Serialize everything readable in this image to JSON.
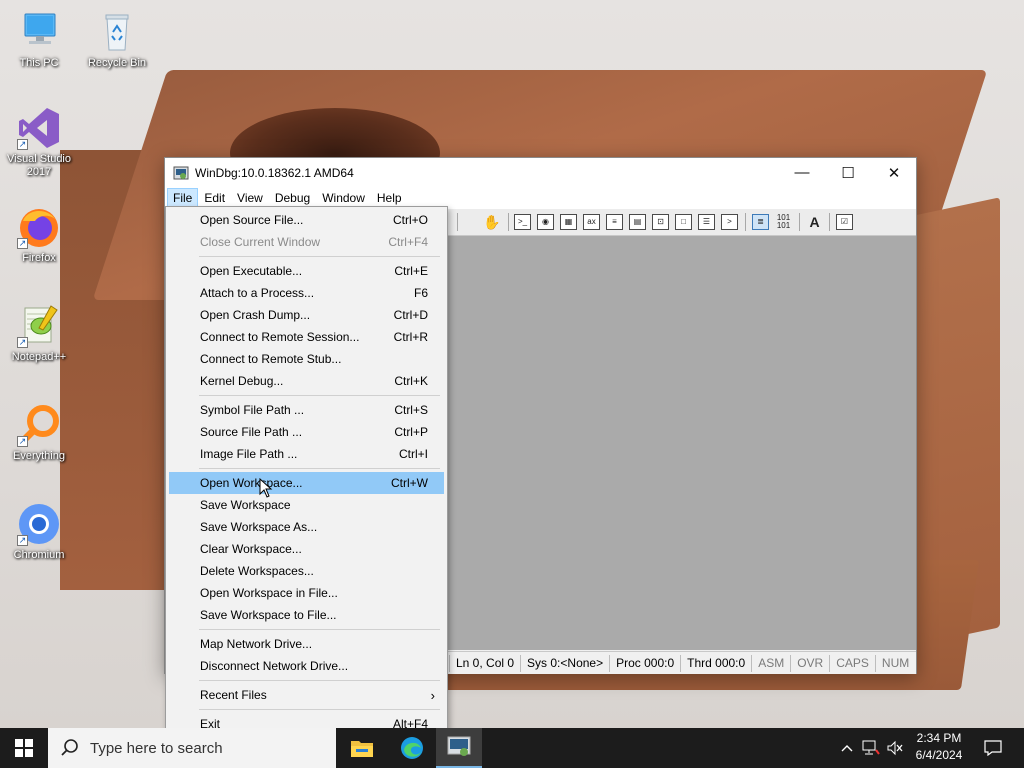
{
  "desktop": {
    "icons": [
      {
        "label": "This PC",
        "icon": "this-pc-icon"
      },
      {
        "label": "Recycle Bin",
        "icon": "recycle-bin-icon"
      },
      {
        "label": "Visual Studio 2017",
        "icon": "visual-studio-icon"
      },
      {
        "label": "Firefox",
        "icon": "firefox-icon"
      },
      {
        "label": "Notepad++",
        "icon": "notepadpp-icon"
      },
      {
        "label": "Everything",
        "icon": "everything-icon"
      },
      {
        "label": "Chromium",
        "icon": "chromium-icon"
      }
    ]
  },
  "window": {
    "title": "WinDbg:10.0.18362.1 AMD64",
    "controls": {
      "minimize": "—",
      "maximize": "☐",
      "close": "✕"
    },
    "menubar": [
      "File",
      "Edit",
      "View",
      "Debug",
      "Window",
      "Help"
    ],
    "toolbar": {
      "buttons": [
        "hand-icon",
        "command-window-icon",
        "watch-icon",
        "locals-icon",
        "registers-icon",
        "memory-icon",
        "call-stack-icon",
        "disassembly-icon",
        "scratch-pad-icon",
        "processes-threads-icon",
        "command-browser-icon",
        "source-mode-icon",
        "hex-mode-icon",
        "font-icon",
        "options-icon"
      ],
      "hex_label": "101",
      "font_label": "A"
    },
    "status": {
      "position": "Ln 0, Col 0",
      "sys": "Sys 0:<None>",
      "proc": "Proc 000:0",
      "thrd": "Thrd 000:0",
      "asm": "ASM",
      "ovr": "OVR",
      "caps": "CAPS",
      "num": "NUM"
    }
  },
  "file_menu": {
    "groups": [
      [
        {
          "label": "Open Source File...",
          "shortcut": "Ctrl+O"
        },
        {
          "label": "Close Current Window",
          "shortcut": "Ctrl+F4",
          "disabled": true
        }
      ],
      [
        {
          "label": "Open Executable...",
          "shortcut": "Ctrl+E"
        },
        {
          "label": "Attach to a Process...",
          "shortcut": "F6"
        },
        {
          "label": "Open Crash Dump...",
          "shortcut": "Ctrl+D"
        },
        {
          "label": "Connect to Remote Session...",
          "shortcut": "Ctrl+R"
        },
        {
          "label": "Connect to Remote Stub...",
          "shortcut": ""
        },
        {
          "label": "Kernel Debug...",
          "shortcut": "Ctrl+K"
        }
      ],
      [
        {
          "label": "Symbol File Path ...",
          "shortcut": "Ctrl+S"
        },
        {
          "label": "Source File Path ...",
          "shortcut": "Ctrl+P"
        },
        {
          "label": "Image File Path ...",
          "shortcut": "Ctrl+I"
        }
      ],
      [
        {
          "label": "Open Workspace...",
          "shortcut": "Ctrl+W",
          "highlighted": true
        },
        {
          "label": "Save Workspace",
          "shortcut": ""
        },
        {
          "label": "Save Workspace As...",
          "shortcut": ""
        },
        {
          "label": "Clear Workspace...",
          "shortcut": ""
        },
        {
          "label": "Delete Workspaces...",
          "shortcut": ""
        },
        {
          "label": "Open Workspace in File...",
          "shortcut": ""
        },
        {
          "label": "Save Workspace to File...",
          "shortcut": ""
        }
      ],
      [
        {
          "label": "Map Network Drive...",
          "shortcut": ""
        },
        {
          "label": "Disconnect Network Drive...",
          "shortcut": ""
        }
      ],
      [
        {
          "label": "Recent Files",
          "shortcut": "",
          "submenu": true
        }
      ],
      [
        {
          "label": "Exit",
          "shortcut": "Alt+F4"
        }
      ]
    ]
  },
  "taskbar": {
    "search_placeholder": "Type here to search",
    "apps": [
      "file-explorer-icon",
      "edge-icon",
      "windbg-icon"
    ],
    "tray": [
      "chevron-up-icon",
      "network-icon",
      "volume-muted-icon"
    ],
    "time": "2:34 PM",
    "date": "6/4/2024",
    "notification_icon": "notification-icon"
  },
  "colors": {
    "menu_highlight": "#91c9f7",
    "menubar_active": "#cce8ff",
    "client_area": "#aaaaaa",
    "taskbar": "#1c1c1c"
  }
}
